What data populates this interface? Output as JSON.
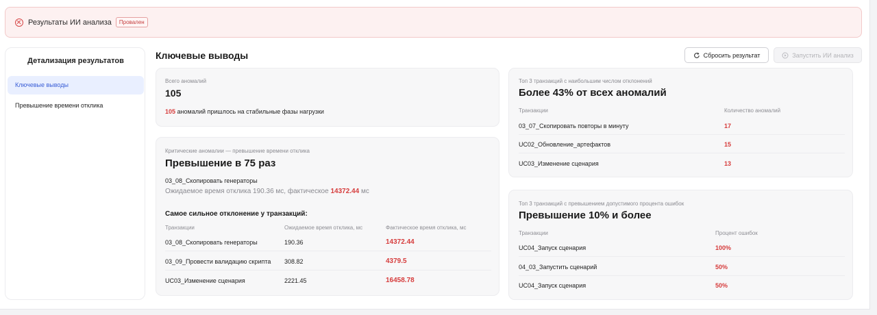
{
  "banner": {
    "title": "Результаты ИИ анализа",
    "badge": "Провален"
  },
  "sidebar": {
    "title": "Детализация результатов",
    "items": [
      {
        "label": "Ключевые выводы",
        "active": true
      },
      {
        "label": "Превышение времени отклика",
        "active": false
      }
    ]
  },
  "main": {
    "title": "Ключевые выводы",
    "reset_label": "Сбросить результат",
    "run_label": "Запустить ИИ анализ"
  },
  "total": {
    "label": "Всего аномалий",
    "value": "105",
    "note_value": "105",
    "note_text": "аномалий пришлось на стабильные фазы нагрузки"
  },
  "critical": {
    "label": "Критические аномалии — превышение времени отклика",
    "heading": "Превышение в 75 раз",
    "transaction": "03_08_Скопировать генераторы",
    "expected_text": "Ожидаемое время отклика 190.36 мс, фактическое",
    "actual_value": "14372.44",
    "actual_unit": "мс",
    "table_title": "Самое сильное отклонение у транзакций:",
    "columns": [
      "Транзакции",
      "Ожидаемое время отклика, мс",
      "Фактическое время отклика, мс"
    ],
    "rows": [
      {
        "name": "03_08_Скопировать генераторы",
        "expected": "190.36",
        "actual": "14372.44"
      },
      {
        "name": "03_09_Провести валидацию скрипта",
        "expected": "308.82",
        "actual": "4379.5"
      },
      {
        "name": "UC03_Изменение сценария",
        "expected": "2221.45",
        "actual": "16458.78"
      }
    ]
  },
  "top_anomalies": {
    "label": "Топ 3 транзакций с наибольшим числом отклонений",
    "heading": "Более 43% от всех аномалий",
    "columns": [
      "Транзакции",
      "Количество аномалий"
    ],
    "rows": [
      {
        "name": "03_07_Скопировать повторы в минуту",
        "value": "17"
      },
      {
        "name": "UC02_Обновление_артефактов",
        "value": "15"
      },
      {
        "name": "UC03_Изменение сценария",
        "value": "13"
      }
    ]
  },
  "top_errors": {
    "label": "Топ 3 транзакций с превышением допустимого процента ошибок",
    "heading": "Превышение 10% и более",
    "columns": [
      "Транзакции",
      "Процент ошибок"
    ],
    "rows": [
      {
        "name": "UC04_Запуск сценария",
        "value": "100%"
      },
      {
        "name": "04_03_Запустить сценарий",
        "value": "50%"
      },
      {
        "name": "UC04_Запуск сценария",
        "value": "50%"
      }
    ]
  },
  "colors": {
    "accent_red": "#d63c3c",
    "active_blue": "#3a5ed6",
    "active_bg": "#e9efff",
    "banner_bg": "#fdf1f1"
  },
  "icons": {
    "banner": "error-circle-icon",
    "reset": "refresh-icon",
    "run": "play-circle-icon"
  }
}
